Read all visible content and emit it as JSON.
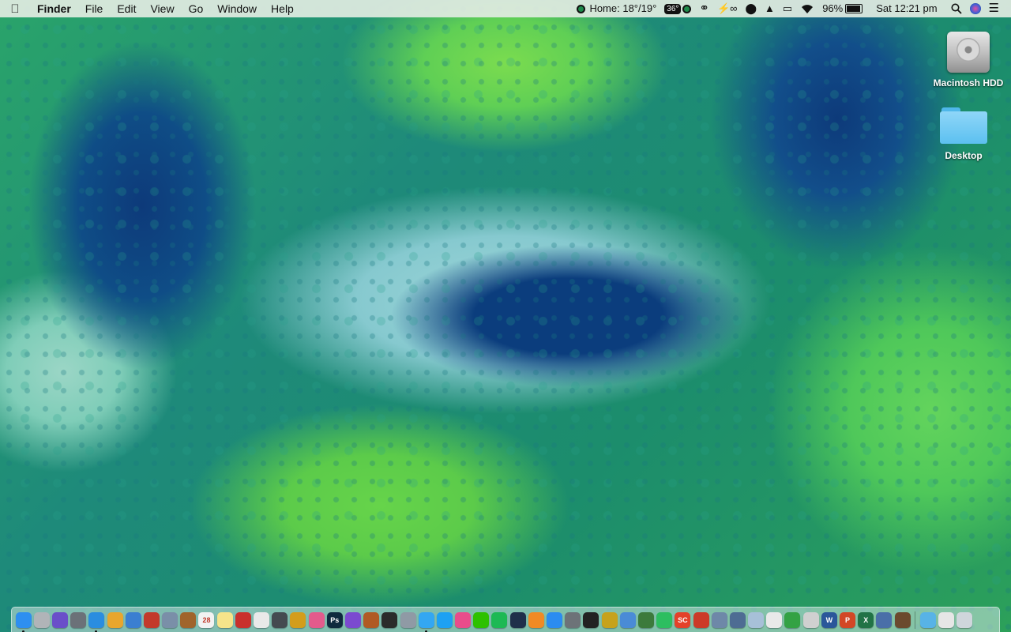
{
  "menubar": {
    "apple_icon": "apple-icon",
    "app_name": "Finder",
    "menus": [
      "File",
      "Edit",
      "View",
      "Go",
      "Window",
      "Help"
    ],
    "weather": "Home: 18°/19°",
    "badge": "36°",
    "battery_percent": "96%",
    "clock": "Sat 12:21 pm"
  },
  "desktop": {
    "icons": [
      {
        "label": "Macintosh HDD",
        "icon": "hard-drive-icon"
      },
      {
        "label": "Desktop",
        "icon": "folder-icon"
      }
    ]
  },
  "dock": {
    "items": [
      {
        "name": "finder",
        "color": "#2e8ff0"
      },
      {
        "name": "preview",
        "color": "#b0b4b8"
      },
      {
        "name": "siri",
        "color": "#6a4fc9"
      },
      {
        "name": "launchpad",
        "color": "#6b7178"
      },
      {
        "name": "safari",
        "color": "#2a8de0"
      },
      {
        "name": "chrome",
        "color": "#e8a62d"
      },
      {
        "name": "keynote",
        "color": "#3b7fd1"
      },
      {
        "name": "photo-booth",
        "color": "#c23a2b"
      },
      {
        "name": "image-capture",
        "color": "#7a8fa8"
      },
      {
        "name": "notefile",
        "color": "#a0642c"
      },
      {
        "name": "calendar",
        "color": "#f2f2f2",
        "text": "28"
      },
      {
        "name": "notes",
        "color": "#f6e48a"
      },
      {
        "name": "acrobat",
        "color": "#c9302c"
      },
      {
        "name": "textedit",
        "color": "#e9e9e9"
      },
      {
        "name": "sketchbook",
        "color": "#444a50"
      },
      {
        "name": "compass",
        "color": "#d39d1c"
      },
      {
        "name": "color-picker",
        "color": "#e35b8c"
      },
      {
        "name": "photoshop",
        "color": "#0f2a3e",
        "text": "Ps"
      },
      {
        "name": "imovie-star",
        "color": "#7b4ad0"
      },
      {
        "name": "toolbox",
        "color": "#b05a24"
      },
      {
        "name": "final-cut",
        "color": "#2b2b2b"
      },
      {
        "name": "automator",
        "color": "#8f9aa5"
      },
      {
        "name": "messages",
        "color": "#33a7f2"
      },
      {
        "name": "twitter",
        "color": "#1da1f2"
      },
      {
        "name": "itunes",
        "color": "#e94c8b"
      },
      {
        "name": "wechat",
        "color": "#2dc100"
      },
      {
        "name": "spotify",
        "color": "#1db954"
      },
      {
        "name": "steam",
        "color": "#1f2f4a"
      },
      {
        "name": "books",
        "color": "#f08a24"
      },
      {
        "name": "app-store",
        "color": "#2b8cf0"
      },
      {
        "name": "system-prefs",
        "color": "#6d7378"
      },
      {
        "name": "terminal",
        "color": "#222222"
      },
      {
        "name": "wunderlist",
        "color": "#c6a21b"
      },
      {
        "name": "maps",
        "color": "#4a8bd6"
      },
      {
        "name": "vectorize",
        "color": "#3c7a3c"
      },
      {
        "name": "evernote",
        "color": "#2dbe60"
      },
      {
        "name": "sc-app",
        "color": "#e4412a",
        "text": "SC"
      },
      {
        "name": "game-app",
        "color": "#cc3a28"
      },
      {
        "name": "photos-folder",
        "color": "#6e88a8"
      },
      {
        "name": "unarchiver",
        "color": "#4e6c93"
      },
      {
        "name": "sequel",
        "color": "#a7c0d8"
      },
      {
        "name": "grapher",
        "color": "#e9e9e9"
      },
      {
        "name": "numbers",
        "color": "#33a244"
      },
      {
        "name": "handbrake",
        "color": "#d0d0d0"
      },
      {
        "name": "word",
        "color": "#2b579a",
        "text": "W"
      },
      {
        "name": "powerpoint",
        "color": "#d24726",
        "text": "P"
      },
      {
        "name": "excel",
        "color": "#217346",
        "text": "X"
      },
      {
        "name": "screen-app",
        "color": "#4a6fa8"
      },
      {
        "name": "dvd-player",
        "color": "#6b4a2e"
      }
    ],
    "trailing": [
      {
        "name": "downloads-stack",
        "color": "#58b3e6"
      },
      {
        "name": "documents-stack",
        "color": "#e6e6e6"
      },
      {
        "name": "trash",
        "color": "#cfd6dc"
      }
    ]
  }
}
